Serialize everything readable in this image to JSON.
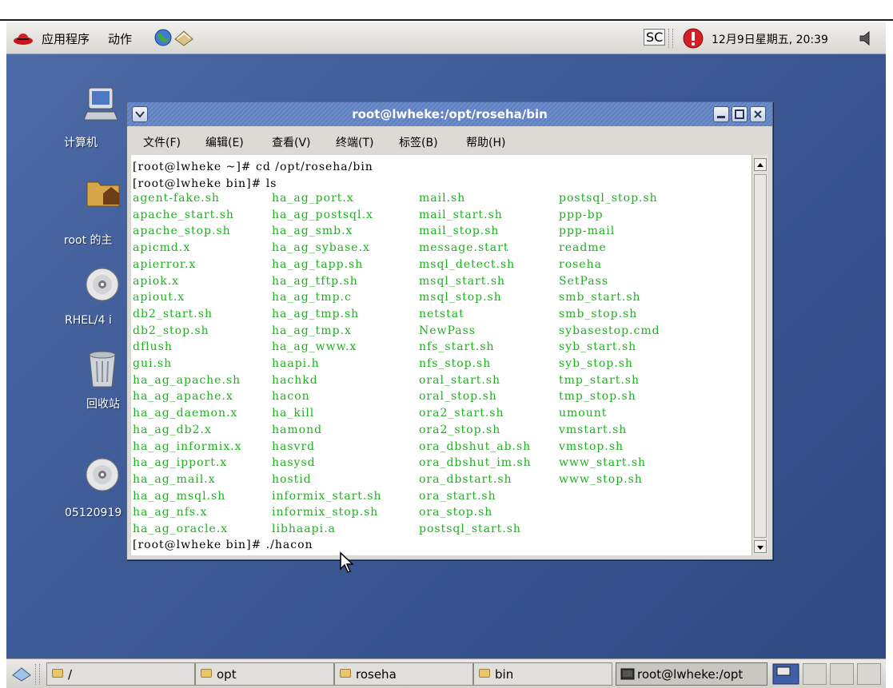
{
  "top_panel": {
    "menu_apps": "应用程序",
    "menu_actions": "动作",
    "tray_sc": "SC",
    "datetime": "12月9日星期五, 20:39"
  },
  "desktop": {
    "icons": [
      {
        "label": "计算机"
      },
      {
        "label": "root 的主"
      },
      {
        "label": "RHEL/4 i"
      },
      {
        "label": "回收站"
      },
      {
        "label": "05120919"
      }
    ]
  },
  "window": {
    "title": "root@lwheke:/opt/roseha/bin",
    "menus": [
      "文件(F)",
      "编辑(E)",
      "查看(V)",
      "终端(T)",
      "标签(B)",
      "帮助(H)"
    ],
    "lines": {
      "cmd1": "[root@lwheke ~]# cd /opt/roseha/bin",
      "cmd2": "[root@lwheke bin]# ls",
      "cmd3": "[root@lwheke bin]# ./hacon"
    },
    "files": {
      "col1": [
        "agent-fake.sh",
        "apache_start.sh",
        "apache_stop.sh",
        "apicmd.x",
        "apierror.x",
        "apiok.x",
        "apiout.x",
        "db2_start.sh",
        "db2_stop.sh",
        "dflush",
        "gui.sh",
        "ha_ag_apache.sh",
        "ha_ag_apache.x",
        "ha_ag_daemon.x",
        "ha_ag_db2.x",
        "ha_ag_informix.x",
        "ha_ag_ipport.x",
        "ha_ag_mail.x",
        "ha_ag_msql.sh",
        "ha_ag_nfs.x",
        "ha_ag_oracle.x"
      ],
      "col2": [
        "ha_ag_port.x",
        "ha_ag_postsql.x",
        "ha_ag_smb.x",
        "ha_ag_sybase.x",
        "ha_ag_tapp.sh",
        "ha_ag_tftp.sh",
        "ha_ag_tmp.c",
        "ha_ag_tmp.sh",
        "ha_ag_tmp.x",
        "ha_ag_www.x",
        "haapi.h",
        "hachkd",
        "hacon",
        "ha_kill",
        "hamond",
        "hasvrd",
        "hasysd",
        "hostid",
        "informix_start.sh",
        "informix_stop.sh",
        "libhaapi.a"
      ],
      "col3": [
        "mail.sh",
        "mail_start.sh",
        "mail_stop.sh",
        "message.start",
        "msql_detect.sh",
        "msql_start.sh",
        "msql_stop.sh",
        "netstat",
        "NewPass",
        "nfs_start.sh",
        "nfs_stop.sh",
        "oral_start.sh",
        "oral_stop.sh",
        "ora2_start.sh",
        "ora2_stop.sh",
        "ora_dbshut_ab.sh",
        "ora_dbshut_im.sh",
        "ora_dbstart.sh",
        "ora_start.sh",
        "ora_stop.sh",
        "postsql_start.sh"
      ],
      "col4": [
        "postsql_stop.sh",
        "ppp-bp",
        "ppp-mail",
        "readme",
        "roseha",
        "SetPass",
        "smb_start.sh",
        "smb_stop.sh",
        "sybasestop.cmd",
        "syb_start.sh",
        "syb_stop.sh",
        "tmp_start.sh",
        "tmp_stop.sh",
        "umount",
        "vmstart.sh",
        "vmstop.sh",
        "www_start.sh",
        "www_stop.sh"
      ]
    }
  },
  "taskbar": {
    "tasks": [
      "/",
      "opt",
      "roseha",
      "bin",
      "root@lwheke:/opt"
    ]
  },
  "colors": {
    "desktop": "#3f5b97",
    "titlebar": "#6e8dcb",
    "file_green": "#1fb01f"
  }
}
